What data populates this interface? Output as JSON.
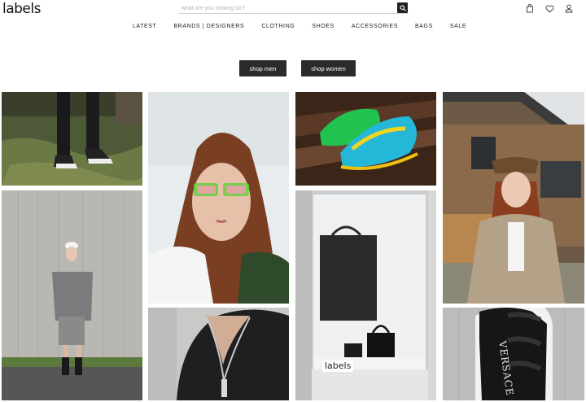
{
  "header": {
    "logo": "labels",
    "search_placeholder": "what are you looking for?",
    "icons": [
      "bag-icon",
      "heart-icon",
      "user-icon"
    ]
  },
  "nav": {
    "items": [
      "LATEST",
      "BRANDS | DESIGNERS",
      "CLOTHING",
      "SHOES",
      "ACCESSORIES",
      "BAGS",
      "SALE"
    ]
  },
  "hero": {
    "shop_men": "shop men",
    "shop_women": "shop women"
  },
  "gallery": {
    "tiles": [
      "legs-sneakers-photo",
      "woman-green-sunglasses-photo",
      "green-blue-sneakers-photo",
      "woman-bucket-hat-photo",
      "person-grey-blazer-photo",
      "shop-window-bags-photo",
      "silver-necklace-photo",
      "black-puffer-vest-photo"
    ],
    "window_sign": "labels",
    "vest_print": "VERSACE"
  },
  "colors": {
    "button_bg": "#2b2b2b",
    "text": "#222222"
  }
}
